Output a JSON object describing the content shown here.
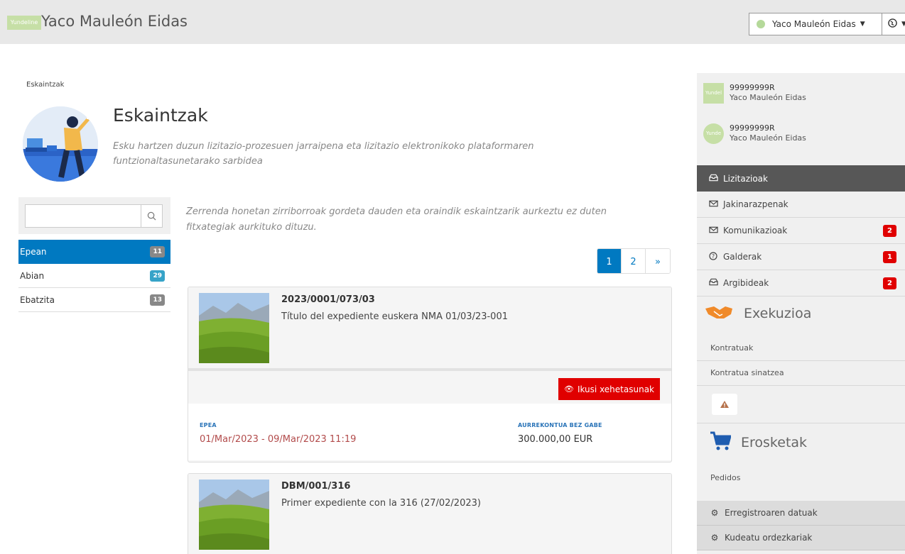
{
  "header": {
    "logo_text": "Yundeline",
    "app_title": "Yaco Mauleón Eidas",
    "user_menu_label": "Yaco Mauleón Eidas",
    "user_icon": "user-status-dot",
    "lang_icon": "globe-icon"
  },
  "breadcrumb": "Eskaintzak",
  "page": {
    "title": "Eskaintzak",
    "subtitle": "Esku hartzen duzun lizitazio-prozesuen jarraipena eta lizitazio elektronikoko plataformaren funtzionaltasunetarako sarbidea"
  },
  "search": {
    "value": "",
    "placeholder": ""
  },
  "filters": [
    {
      "label": "Epean",
      "count": "11",
      "active": true
    },
    {
      "label": "Abian",
      "count": "29",
      "active": false
    },
    {
      "label": "Ebatzita",
      "count": "13",
      "active": false
    }
  ],
  "info_text": "Zerrenda honetan zirriborroak gordeta dauden eta oraindik eskaintzarik aurkeztu ez duten fitxategiak aurkituko dituzu.",
  "pagination": {
    "pages": [
      "1",
      "2"
    ],
    "current": "1",
    "next": "»"
  },
  "cards": [
    {
      "code": "2023/0001/073/03",
      "title": "Título del expediente euskera NMA 01/03/23-001",
      "details_label": "Ikusi xehetasunak",
      "period_label": "EPEA",
      "period_value": "01/Mar/2023 - 09/Mar/2023 11:19",
      "budget_label": "AURREKONTUA BEZ GABE",
      "budget_value": "300.000,00 EUR"
    },
    {
      "code": "DBM/001/316",
      "title": "Primer expediente con la 316 (27/02/2023)"
    }
  ],
  "sidebar": {
    "identities": [
      {
        "logo": "Yundel",
        "number": "99999999R",
        "name": "Yaco Mauleón Eidas"
      },
      {
        "logo": "Yunde",
        "number": "99999999R",
        "name": "Yaco Mauleón Eidas"
      }
    ],
    "nav": [
      {
        "label": "Lizitazioak",
        "icon": "inbox-icon",
        "badge": "",
        "active": true
      },
      {
        "label": "Jakinarazpenak",
        "icon": "envelope-icon",
        "badge": "",
        "active": false
      },
      {
        "label": "Komunikazioak",
        "icon": "envelope-icon",
        "badge": "2",
        "active": false
      },
      {
        "label": "Galderak",
        "icon": "question-icon",
        "badge": "1",
        "active": false
      },
      {
        "label": "Argibideak",
        "icon": "inbox-icon",
        "badge": "2",
        "active": false
      }
    ],
    "execution": {
      "title": "Exekuzioa",
      "icon": "handshake-icon",
      "links": [
        "Kontratuak",
        "Kontratua sinatzea"
      ]
    },
    "purchases": {
      "title": "Erosketak",
      "icon": "cart-icon",
      "links": [
        "Pedidos"
      ]
    },
    "bottom": [
      {
        "label": "Erregistroaren datuak",
        "icon": "gear-icon"
      },
      {
        "label": "Kudeatu ordezkariak",
        "icon": "gear-icon"
      }
    ]
  },
  "colors": {
    "primary": "#0079c1",
    "danger": "#e00000",
    "nav_active": "#575757"
  }
}
